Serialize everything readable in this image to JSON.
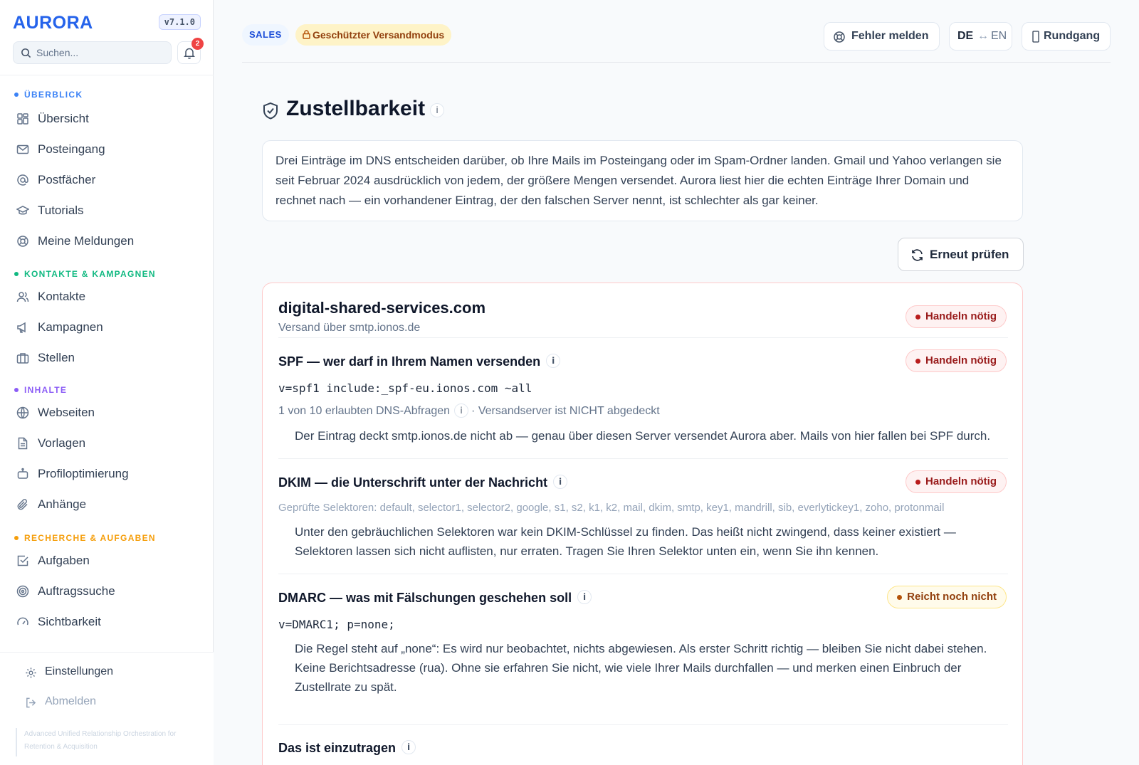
{
  "app": {
    "name": "AURORA",
    "version": "v7.1.0"
  },
  "sidebar": {
    "search_placeholder": "Suchen...",
    "notification_count": "2",
    "sections": [
      {
        "title": "ÜBERBLICK",
        "color": "#3b82f6",
        "items": [
          "Übersicht",
          "Posteingang",
          "Postfächer",
          "Tutorials",
          "Meine Meldungen"
        ]
      },
      {
        "title": "KONTAKTE & KAMPAGNEN",
        "color": "#10b981",
        "items": [
          "Kontakte",
          "Kampagnen",
          "Stellen"
        ]
      },
      {
        "title": "INHALTE",
        "color": "#8b5cf6",
        "items": [
          "Webseiten",
          "Vorlagen",
          "Profiloptimierung",
          "Anhänge"
        ]
      },
      {
        "title": "RECHERCHE & AUFGABEN",
        "color": "#f59e0b",
        "items": [
          "Aufgaben",
          "Auftragssuche",
          "Sichtbarkeit"
        ]
      }
    ],
    "bottom": {
      "settings": "Einstellungen",
      "logout": "Abmelden"
    },
    "tagline": "Advanced Unified Relationship Orchestration for Retention & Acquisition"
  },
  "topbar": {
    "sales_pill": "SALES",
    "protect_pill": "Geschützter Versandmodus",
    "report_bug": "Fehler melden",
    "lang_from": "DE",
    "lang_swap": "↔",
    "lang_to": "EN",
    "tour": "Rundgang"
  },
  "page": {
    "title": "Zustellbarkeit",
    "intro": "Drei Einträge im DNS entscheiden darüber, ob Ihre Mails im Posteingang oder im Spam-Ordner landen. Gmail und Yahoo verlangen sie seit Februar 2024 ausdrücklich von jedem, der größere Mengen versendet. Aurora liest hier die echten Einträge Ihrer Domain und rechnet nach — ein vorhandener Eintrag, der den falschen Server nennt, ist schlechter als gar keiner.",
    "retry_button": "Erneut prüfen"
  },
  "domain_card": {
    "domain": "digital-shared-services.com",
    "via": "Versand über smtp.ionos.de",
    "status": "Handeln nötig",
    "spf": {
      "title": "SPF — wer darf in Ihrem Namen versenden",
      "status": "Handeln nötig",
      "record": "v=spf1 include:_spf-eu.ionos.com ~all",
      "lookups": "1 von 10 erlaubten DNS-Abfragen",
      "coverage": "· Versandserver ist NICHT abgedeckt",
      "note": "Der Eintrag deckt smtp.ionos.de nicht ab — genau über diesen Server versendet Aurora aber. Mails von hier fallen bei SPF durch."
    },
    "dkim": {
      "title": "DKIM — die Unterschrift unter der Nachricht",
      "status": "Handeln nötig",
      "selectors": "Geprüfte Selektoren: default, selector1, selector2, google, s1, s2, k1, k2, mail, dkim, smtp, key1, mandrill, sib, everlytickey1, zoho, protonmail",
      "note": "Unter den gebräuchlichen Selektoren war kein DKIM-Schlüssel zu finden. Das heißt nicht zwingend, dass keiner existiert — Selektoren lassen sich nicht auflisten, nur erraten. Tragen Sie Ihren Selektor unten ein, wenn Sie ihn kennen."
    },
    "dmarc": {
      "title": "DMARC — was mit Fälschungen geschehen soll",
      "status": "Reicht noch nicht",
      "record": "v=DMARC1; p=none;",
      "note": "Die Regel steht auf „none“: Es wird nur beobachtet, nichts abgewiesen. Als erster Schritt richtig — bleiben Sie nicht dabei stehen. Keine Berichtsadresse (rua). Ohne sie erfahren Sie nicht, wie viele Ihrer Mails durchfallen — und merken einen Einbruch der Zustellrate zu spät."
    },
    "to_enter_title": "Das ist einzutragen"
  },
  "icons": {
    "info": "i"
  },
  "colors": {
    "brand": "#2563eb",
    "danger": "#b91c1c",
    "warning": "#b45309"
  }
}
